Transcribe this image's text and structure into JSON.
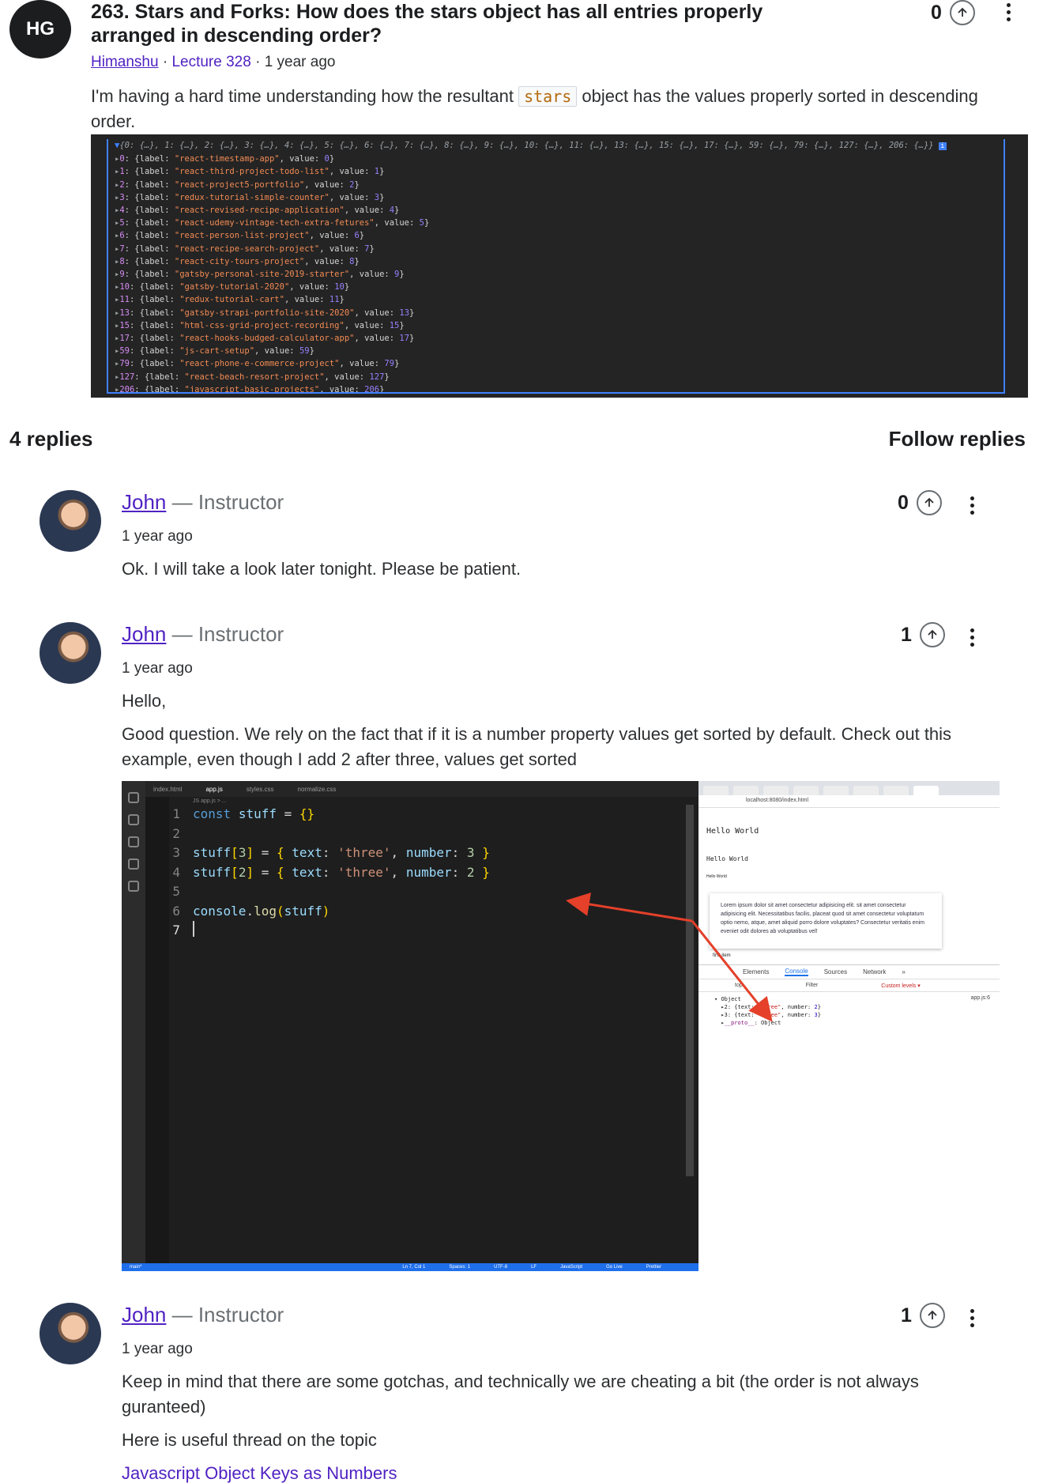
{
  "question": {
    "author_initials": "HG",
    "title": "263. Stars and Forks: How does the stars object has all entries properly arranged in descending order?",
    "author": "Himanshu",
    "sep1": " · ",
    "lecture": "Lecture 328",
    "sep2": " · ",
    "time": "1 year ago",
    "body_before": "I'm having a hard time understanding how the resultant ",
    "body_code": "stars",
    "body_after": " object has the values properly sorted in descending order.",
    "votes": "0",
    "console": {
      "summary": "{0: {…}, 1: {…}, 2: {…}, 3: {…}, 4: {…}, 5: {…}, 6: {…}, 7: {…}, 8: {…}, 9: {…}, 10: {…}, 11: {…}, 13: {…}, 15: {…}, 17: {…}, 59: {…}, 79: {…}, 127: {…}, 206: {…}}",
      "entries": [
        {
          "key": "0",
          "label": "\"react-timestamp-app\"",
          "value": "0"
        },
        {
          "key": "1",
          "label": "\"react-third-project-todo-list\"",
          "value": "1"
        },
        {
          "key": "2",
          "label": "\"react-project5-portfolio\"",
          "value": "2"
        },
        {
          "key": "3",
          "label": "\"redux-tutorial-simple-counter\"",
          "value": "3"
        },
        {
          "key": "4",
          "label": "\"react-revised-recipe-application\"",
          "value": "4"
        },
        {
          "key": "5",
          "label": "\"react-udemy-vintage-tech-extra-fetures\"",
          "value": "5"
        },
        {
          "key": "6",
          "label": "\"react-person-list-project\"",
          "value": "6"
        },
        {
          "key": "7",
          "label": "\"react-recipe-search-project\"",
          "value": "7"
        },
        {
          "key": "8",
          "label": "\"react-city-tours-project\"",
          "value": "8"
        },
        {
          "key": "9",
          "label": "\"gatsby-personal-site-2019-starter\"",
          "value": "9"
        },
        {
          "key": "10",
          "label": "\"gatsby-tutorial-2020\"",
          "value": "10"
        },
        {
          "key": "11",
          "label": "\"redux-tutorial-cart\"",
          "value": "11"
        },
        {
          "key": "13",
          "label": "\"gatsby-strapi-portfolio-site-2020\"",
          "value": "13"
        },
        {
          "key": "15",
          "label": "\"html-css-grid-project-recording\"",
          "value": "15"
        },
        {
          "key": "17",
          "label": "\"react-hooks-budged-calculator-app\"",
          "value": "17"
        },
        {
          "key": "59",
          "label": "\"js-cart-setup\"",
          "value": "59"
        },
        {
          "key": "79",
          "label": "\"react-phone-e-commerce-project\"",
          "value": "79"
        },
        {
          "key": "127",
          "label": "\"react-beach-resort-project\"",
          "value": "127"
        },
        {
          "key": "206",
          "label": "\"javascript-basic-projects\"",
          "value": "206"
        }
      ]
    }
  },
  "replies_header": {
    "count": "4 replies",
    "follow": "Follow replies"
  },
  "replies": [
    {
      "author": "John",
      "role": " — Instructor",
      "time": "1 year ago",
      "votes": "0",
      "text": "Ok. I will take a look later tonight. Please be patient."
    },
    {
      "author": "John",
      "role": " — Instructor",
      "time": "1 year ago",
      "votes": "1",
      "greeting": "Hello,",
      "text": "Good question. We rely on the fact that if it is a number property values get sorted by default. Check out this example, even though I add 2 after three, values get sorted"
    },
    {
      "author": "John",
      "role": " — Instructor",
      "time": "1 year ago",
      "votes": "1",
      "text": "Keep in mind that there are some gotchas, and technically we are cheating a bit (the order is not always guranteed)",
      "text2": "Here is useful thread on the topic",
      "link": "Javascript Object Keys as Numbers"
    }
  ],
  "editor": {
    "tabs": [
      "index.html",
      "app.js",
      "styles.css",
      "normalize.css"
    ],
    "crumb": "JS app.js > ...",
    "line_numbers": [
      "1",
      "2",
      "3",
      "4",
      "5",
      "6",
      "7"
    ],
    "status": [
      "main*",
      "Ln 7, Col 1",
      "Spaces: 1",
      "UTF-8",
      "LF",
      "JavaScript",
      "Go Live",
      "Prettier"
    ]
  },
  "browser": {
    "url": "localhost:8080/index.html",
    "h1": "Hello World",
    "h2": "Hello World",
    "h3": "Hello World",
    "card": "Lorem ipsum dolor sit amet consectetur adipisicing elit. sit amet consectetur adipisicing elit. Necessitatibus facilis, placeat quod sit amet consectetur voluptatum optio nemo, atque, amet aliquid porro dolore voluptates? Consectetur veritatis enim eveniet odit dolores ab voluptatibus vel!",
    "list_item": "first item",
    "devtools_tabs": [
      "Elements",
      "Console",
      "Sources",
      "Network",
      "»"
    ],
    "filter": [
      "top",
      "Filter",
      "Custom levels ▾"
    ],
    "source": "app.js:6",
    "output_obj": "Object",
    "output_line1_key": "2",
    "output_line2_key": "3",
    "output_proto": "__proto__",
    "output_proto_val": ": Object"
  },
  "colors": {
    "link": "#5022c3",
    "console_bg": "#242424",
    "arrow": "#e4402a"
  },
  "icons": [
    "arrow-up-circle-icon",
    "more-vertical-icon"
  ]
}
